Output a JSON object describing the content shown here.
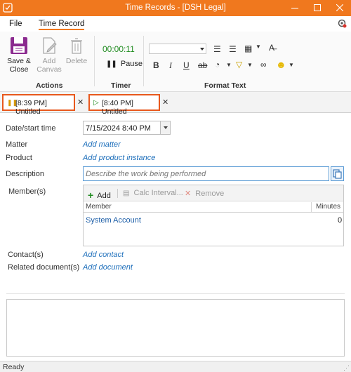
{
  "window": {
    "title": "Time Records - [DSH Legal]",
    "accent_color": "#f0781e",
    "highlight_color": "#e8581d"
  },
  "menu": {
    "file": "File",
    "time_record": "Time Record"
  },
  "ribbon": {
    "actions": {
      "save_close": [
        "Save &",
        "Close"
      ],
      "add_canvas": [
        "Add",
        "Canvas"
      ],
      "delete": "Delete",
      "group_label": "Actions"
    },
    "timer": {
      "value": "00:00:11",
      "pause_label": "Pause",
      "group_label": "Timer"
    },
    "format_text": {
      "group_label": "Format Text"
    }
  },
  "tabs": [
    {
      "label": "[8:39 PM] Untitled",
      "state": "paused"
    },
    {
      "label": "[8:40 PM] Untitled",
      "state": "running"
    }
  ],
  "form": {
    "date_label": "Date/start time",
    "date_value": "7/15/2024 8:40 PM",
    "matter_label": "Matter",
    "matter_link": "Add matter",
    "product_label": "Product",
    "product_link": "Add product instance",
    "description_label": "Description",
    "description_placeholder": "Describe the work being performed",
    "members_label": "Member(s)",
    "members_toolbar": {
      "add": "Add",
      "calc": "Calc Interval...",
      "remove": "Remove"
    },
    "members_columns": [
      "Member",
      "Minutes"
    ],
    "members_rows": [
      {
        "member": "System Account",
        "minutes": "0"
      }
    ],
    "contacts_label": "Contact(s)",
    "contacts_link": "Add contact",
    "related_label": "Related document(s)",
    "related_link": "Add document"
  },
  "status": {
    "text": "Ready"
  }
}
